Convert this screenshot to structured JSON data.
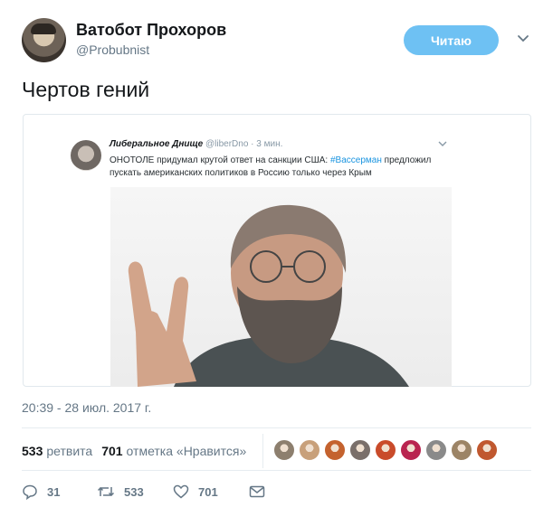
{
  "author": {
    "name": "Ватобот Прохоров",
    "handle": "@Probubnist",
    "follow_label": "Читаю"
  },
  "tweet": {
    "text": "Чертов гений",
    "timestamp": "20:39 - 28 июл. 2017 г."
  },
  "quoted": {
    "name": "Либеральное Днище",
    "handle": "@liberDno",
    "time": "· 3 мин.",
    "text_before": "ОНОТОЛЕ придумал крутой ответ на санкции США:",
    "hashtag": "#Вассерман",
    "text_after": "предложил пускать американских политиков в Россию только через Крым"
  },
  "stats": {
    "retweets_count": "533",
    "retweets_label": "ретвита",
    "likes_count": "701",
    "likes_label": "отметка «Нравится»",
    "liker_colors": [
      "#8d7f6e",
      "#c8a07a",
      "#c4622e",
      "#7a6f6a",
      "#c94b2a",
      "#b9244f",
      "#8a8a8a",
      "#9c8466",
      "#c0582f"
    ]
  },
  "actions": {
    "reply_count": "31",
    "retweet_count": "533",
    "like_count": "701"
  },
  "colors": {
    "accent": "#1da1f2",
    "follow_button": "#6ec1f3",
    "muted_text": "#657786"
  }
}
